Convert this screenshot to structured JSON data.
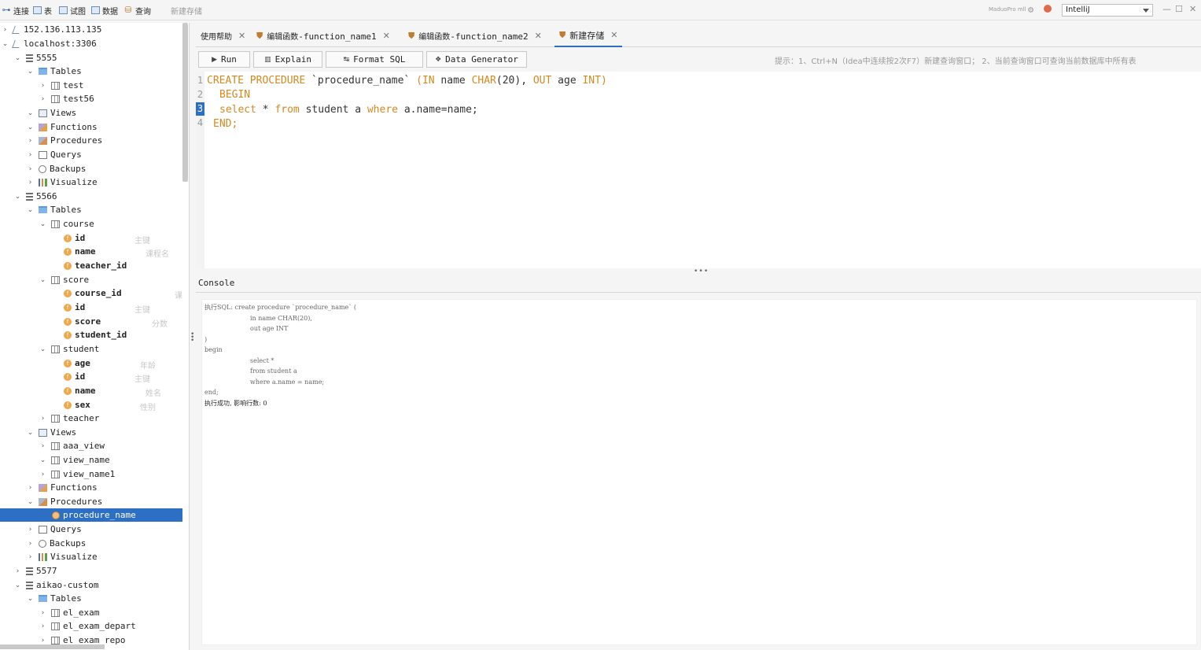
{
  "toolbar": {
    "connect": "连接",
    "table": "表",
    "view": "试图",
    "data": "数据",
    "query": "查询",
    "new_proc": "新建存储",
    "brand": "MaduoPro mll",
    "theme": "IntelliJ"
  },
  "tree": {
    "conn1": "152.136.113.135",
    "conn2": "localhost:3306",
    "db_5555": "5555",
    "tables": "Tables",
    "test": "test",
    "test56": "test56",
    "views": "Views",
    "functions": "Functions",
    "procedures": "Procedures",
    "querys": "Querys",
    "backups": "Backups",
    "visualize": "Visualize",
    "db_5566": "5566",
    "course": "course",
    "id": "id",
    "name": "name",
    "teacher_id": "teacher_id",
    "score": "score",
    "course_id": "course_id",
    "student_id": "student_id",
    "student": "student",
    "age": "age",
    "sex": "sex",
    "teacher": "teacher",
    "aaa_view": "aaa_view",
    "view_name": "view_name",
    "view_name1": "view_name1",
    "procedure_name": "procedure_name",
    "db_5577": "5577",
    "db_aikao": "aikao-custom",
    "el_exam": "el_exam",
    "el_exam_depart": "el_exam_depart",
    "el_exam_repo": "el_exam_repo",
    "comments": {
      "pk": "主键",
      "course_name": "课程名",
      "course_short": "课",
      "score": "分数",
      "age": "年龄",
      "name": "姓名",
      "sex": "性别"
    }
  },
  "tabs": [
    {
      "label": "使用帮助"
    },
    {
      "label_cn": "编辑函数",
      "label_en": "-function_name1"
    },
    {
      "label_cn": "编辑函数",
      "label_en": "-function_name2"
    },
    {
      "label": "新建存储"
    }
  ],
  "actions": {
    "run": "Run",
    "explain": "Explain",
    "format": "Format SQL",
    "generator": "Data Generator"
  },
  "hint": "提示：1、Ctrl+N（Idea中连续按2次F7）新建查询窗口； 2、当前查询窗口可查询当前数据库中所有表",
  "editor": {
    "line_numbers": [
      "1",
      "2",
      "3",
      "4"
    ],
    "l1": {
      "a": "CREATE PROCEDURE",
      "b": " `procedure_name` ",
      "c": "(IN",
      "d": " name ",
      "e": "CHAR",
      "f": "(20), ",
      "g": "OUT",
      "h": " age ",
      "i": "INT)"
    },
    "l2": {
      "a": "BEGIN"
    },
    "l3": {
      "a": "select",
      "b": " * ",
      "c": "from",
      "d": " student a ",
      "e": "where",
      "f": " a.name=name;"
    },
    "l4": {
      "a": "END;"
    }
  },
  "console": {
    "title": "Console",
    "lines": [
      "执行SQL: create procedure `procedure_name` (",
      "in name CHAR(20),",
      "out age INT",
      ")",
      "begin",
      "select *",
      "from student a",
      "where a.name = name;",
      "end;",
      "执行成功, 影响行数: 0"
    ]
  }
}
